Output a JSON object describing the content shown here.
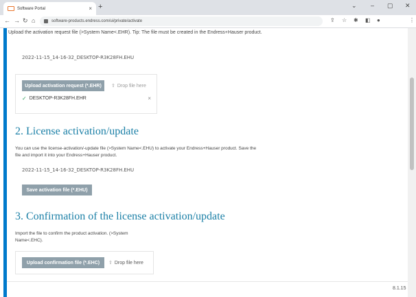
{
  "browser": {
    "tab_title": "Software Portal",
    "new_tab": "+",
    "close_tab": "×",
    "url": "software-products.endress.com/ui/private/activate",
    "window_controls": {
      "dropdown": "⌄",
      "minimize": "–",
      "restore": "▢",
      "close": "✕"
    }
  },
  "section1": {
    "intro": "Upload the activation request file (>System Name<.EHR). Tip: The file must be created in the Endress+Hauser product.",
    "generated_filename": "2022-11-15_14-16-32_DESKTOP-R3K28FH.EHU",
    "upload_button": "Upload activation request (*.EHR)",
    "drop_label": "Drop file here",
    "uploaded_file": "DESKTOP-R3K28FH.EHR",
    "remove_icon": "×"
  },
  "section2": {
    "heading": "2. License activation/update",
    "description": "You can use the license-activation/-update file (>System Name<.EHU) to activate your Endress+Hauser product. Save the file and import it into your Endress+Hauser product.",
    "filename": "2022-11-15_14-16-32_DESKTOP-R3K28FH.EHU",
    "save_button": "Save activation file (*.EHU)"
  },
  "section3": {
    "heading": "3. Confirmation of the license activation/update",
    "description": "Import the file to confirm the product activation. (>System Name<.EHC).",
    "upload_button": "Upload confirmation file (*.EHC)",
    "drop_label": "Drop file here"
  },
  "footer": {
    "version": "8.1.15"
  },
  "colors": {
    "accent": "#007acc",
    "heading": "#1a7fa6",
    "button": "#8fa0aa",
    "success": "#2e9e5b"
  }
}
